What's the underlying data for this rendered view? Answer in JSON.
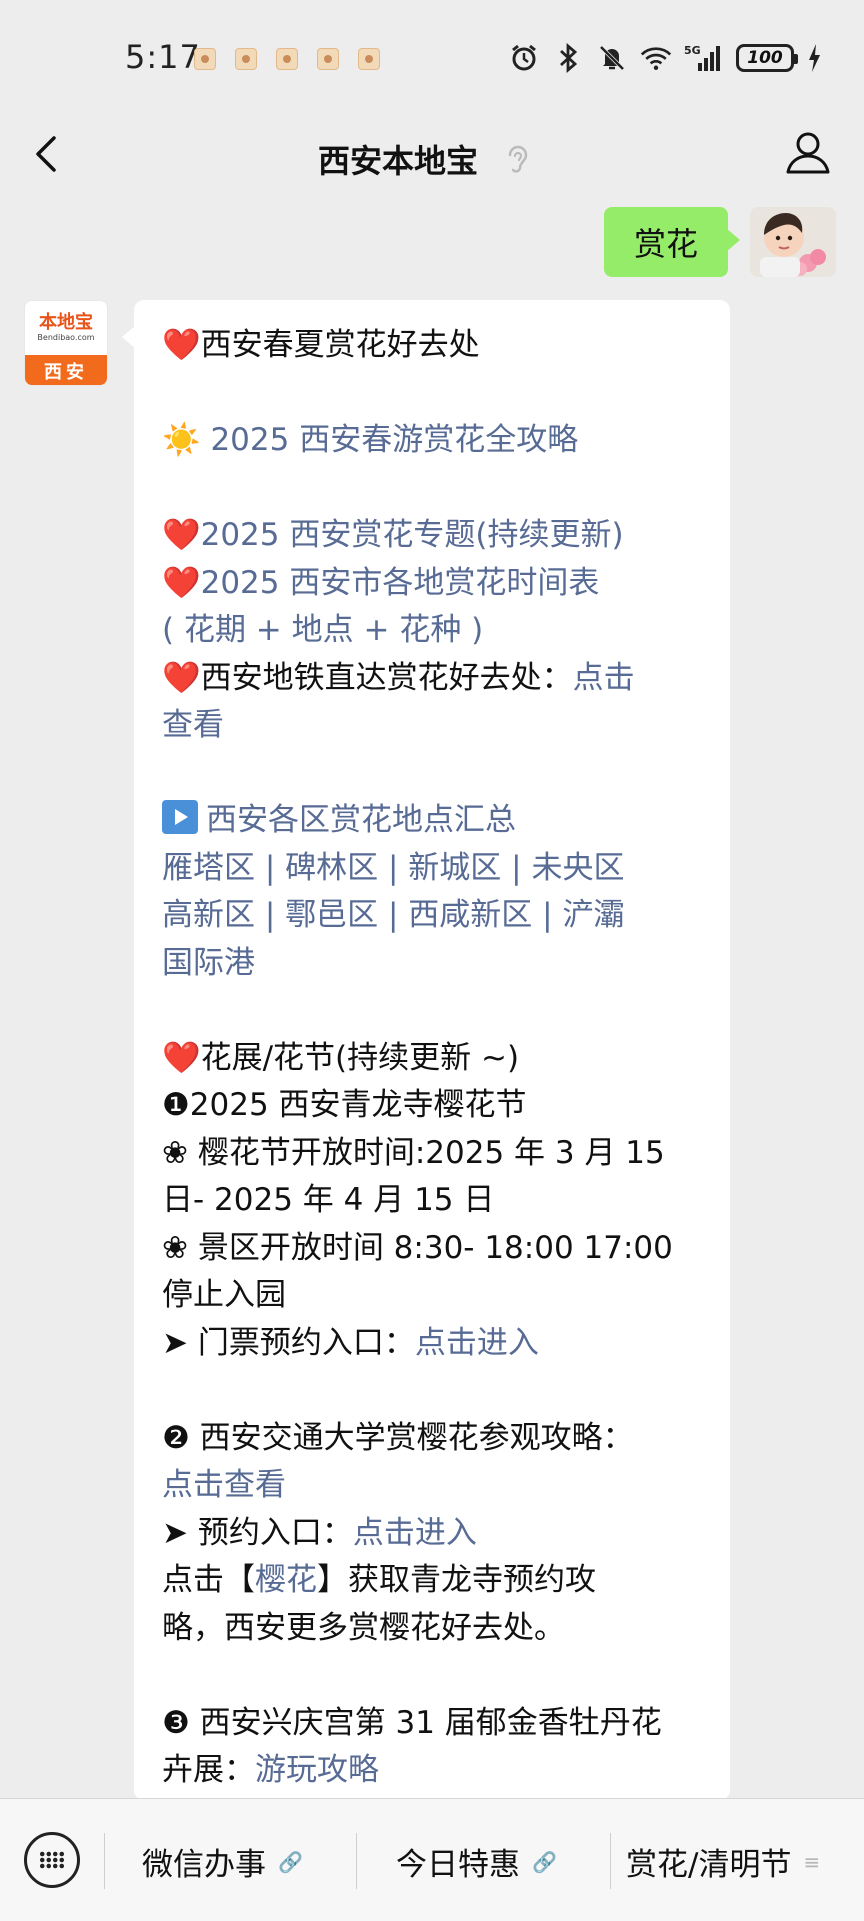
{
  "status_bar": {
    "time": "5:17",
    "battery": "100"
  },
  "header": {
    "title": "西安本地宝"
  },
  "user_message": {
    "text": "赏花"
  },
  "bot_avatar": {
    "logo": "本地宝",
    "url": "Bendibao.com",
    "city": "西安"
  },
  "bot_message": {
    "l1": "西安春夏赏花好去处",
    "l2": "2025 西安春游赏花全攻略",
    "l3": "2025 西安赏花专题(持续更新)",
    "l4": "2025 西安市各地赏花时间表",
    "l5": "( 花期 + 地点 + 花种 )",
    "l6_text": "西安地铁直达赏花好去处：",
    "l6_link": "点击",
    "l7": "查看",
    "l8": "西安各区赏花地点汇总",
    "l9": "雁塔区 | 碑林区 | 新城区 | 未央区",
    "l10": "高新区 | 鄠邑区 | 西咸新区 | 浐灞",
    "l11": "国际港",
    "l12": "花展/花节(持续更新 ~)",
    "l13": "❶2025 西安青龙寺樱花节",
    "l14": "❀ 樱花节开放时间:2025 年 3 月 15",
    "l15": "日- 2025 年 4 月 15 日",
    "l16": "❀ 景区开放时间 8:30- 18:00 17:00",
    "l17": "停止入园",
    "l18_text": "➤ 门票预约入口：",
    "l18_link": "点击进入",
    "l19": "❷ 西安交通大学赏樱花参观攻略：",
    "l20": "点击查看",
    "l21_text": "➤ 预约入口：",
    "l21_link": "点击进入",
    "l22_a": "点击【",
    "l22_link": "樱花",
    "l22_b": "】获取青龙寺预约攻",
    "l23": "略，西安更多赏樱花好去处。",
    "l24": "❸ 西安兴庆宫第 31 届郁金香牡丹花",
    "l25_text": "卉展：",
    "l25_link": "游玩攻略"
  },
  "bottom_menu": {
    "items": [
      "微信办事",
      "今日特惠",
      "赏花/清明节"
    ]
  },
  "colors": {
    "user_bubble": "#95ec69",
    "link": "#576b95",
    "brand_orange": "#f26a1b"
  }
}
